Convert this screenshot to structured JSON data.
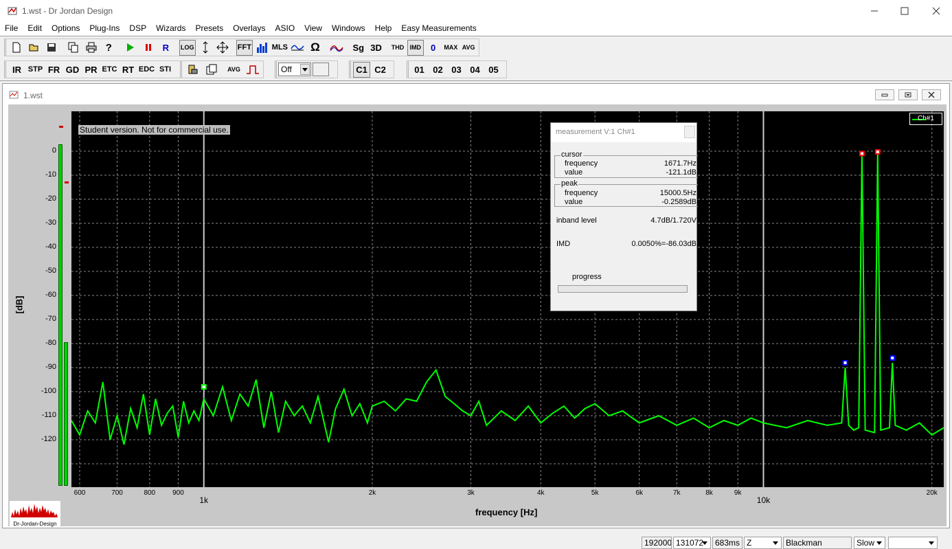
{
  "app": {
    "title": "1.wst - Dr Jordan Design"
  },
  "menu": [
    "File",
    "Edit",
    "Options",
    "Plug-Ins",
    "DSP",
    "Wizards",
    "Presets",
    "Overlays",
    "ASIO",
    "View",
    "Windows",
    "Help",
    "Easy Measurements"
  ],
  "toolbar1": {
    "log": "LOG",
    "fft": "FFT",
    "mls": "MLS",
    "sg": "Sg",
    "three_d": "3D",
    "thd": "THD",
    "imd": "IMD",
    "zero": "0",
    "max": "MAX",
    "avg": "AVG"
  },
  "toolbar2": {
    "ir": "IR",
    "stp": "STP",
    "fr": "FR",
    "gd": "GD",
    "pr": "PR",
    "etc": "ETC",
    "rt": "RT",
    "edc": "EDC",
    "sti": "STI",
    "avg": "AVG",
    "off_value": "Off",
    "c1": "C1",
    "c2": "C2",
    "presets": [
      "01",
      "02",
      "03",
      "04",
      "05"
    ]
  },
  "child": {
    "title": "1.wst"
  },
  "graph": {
    "student_notice": "Student version. Not for commercial use.",
    "legend": "Ch#1",
    "logo_text": "Dr-Jordan-Design"
  },
  "measurement": {
    "title": "measurement V:1 Ch#1",
    "cursor_label": "cursor",
    "cursor_freq_label": "frequency",
    "cursor_freq": "1671.7Hz",
    "cursor_value_label": "value",
    "cursor_value": "-121.1dB",
    "peak_label": "peak",
    "peak_freq_label": "frequency",
    "peak_freq": "15000.5Hz",
    "peak_value_label": "value",
    "peak_value": "-0.2589dB",
    "inband_label": "inband level",
    "inband_value": "4.7dB/1.720V",
    "imd_label": "IMD",
    "imd_value": "0.0050%=-86.03dB",
    "progress_label": "progress",
    "progress": 0
  },
  "status": {
    "rate": "192000",
    "fft_size": "131072",
    "duration": "683ms",
    "weighting": "Z",
    "window": "Blackman",
    "speed": "Slow",
    "extra": ""
  },
  "colors": {
    "trace": "#00ff00",
    "plot_bg": "#000000",
    "marker_red": "#ff0000",
    "marker_blue": "#0000ff"
  },
  "chart_data": {
    "type": "line",
    "xlabel": "frequency [Hz]",
    "ylabel": "[dB]",
    "x_scale": "log",
    "xlim": [
      580,
      21000
    ],
    "ylim": [
      -140,
      10
    ],
    "y_ticks": [
      "0",
      "-10",
      "-20",
      "-30",
      "-40",
      "-50",
      "-60",
      "-70",
      "-80",
      "-90",
      "-100",
      "-110",
      "-120"
    ],
    "x_ticks_minor": [
      {
        "value": 600,
        "label": "600"
      },
      {
        "value": 700,
        "label": "700"
      },
      {
        "value": 800,
        "label": "800"
      },
      {
        "value": 900,
        "label": "900"
      },
      {
        "value": 2000,
        "label": "2k"
      },
      {
        "value": 3000,
        "label": "3k"
      },
      {
        "value": 4000,
        "label": "4k"
      },
      {
        "value": 5000,
        "label": "5k"
      },
      {
        "value": 6000,
        "label": "6k"
      },
      {
        "value": 7000,
        "label": "7k"
      },
      {
        "value": 8000,
        "label": "8k"
      },
      {
        "value": 9000,
        "label": "9k"
      },
      {
        "value": 20000,
        "label": "20k"
      }
    ],
    "x_ticks_major": [
      {
        "value": 1000,
        "label": "1k"
      },
      {
        "value": 10000,
        "label": "10k"
      }
    ],
    "grid": true,
    "legend_position": "top-right",
    "series": [
      {
        "name": "Ch#1",
        "points": [
          [
            580,
            -112
          ],
          [
            600,
            -118
          ],
          [
            620,
            -108
          ],
          [
            640,
            -113
          ],
          [
            660,
            -96
          ],
          [
            680,
            -120
          ],
          [
            700,
            -110
          ],
          [
            720,
            -122
          ],
          [
            740,
            -107
          ],
          [
            760,
            -115
          ],
          [
            780,
            -101
          ],
          [
            800,
            -118
          ],
          [
            820,
            -103
          ],
          [
            840,
            -114
          ],
          [
            860,
            -109
          ],
          [
            880,
            -106
          ],
          [
            900,
            -119
          ],
          [
            920,
            -104
          ],
          [
            940,
            -113
          ],
          [
            960,
            -108
          ],
          [
            980,
            -112
          ],
          [
            1000,
            -103
          ],
          [
            1040,
            -110
          ],
          [
            1080,
            -98
          ],
          [
            1120,
            -112
          ],
          [
            1160,
            -101
          ],
          [
            1200,
            -106
          ],
          [
            1240,
            -95
          ],
          [
            1280,
            -115
          ],
          [
            1320,
            -100
          ],
          [
            1360,
            -117
          ],
          [
            1400,
            -104
          ],
          [
            1450,
            -110
          ],
          [
            1500,
            -106
          ],
          [
            1550,
            -113
          ],
          [
            1600,
            -102
          ],
          [
            1671,
            -121
          ],
          [
            1720,
            -107
          ],
          [
            1780,
            -99
          ],
          [
            1840,
            -110
          ],
          [
            1900,
            -105
          ],
          [
            1960,
            -113
          ],
          [
            2000,
            -106
          ],
          [
            2100,
            -104
          ],
          [
            2200,
            -108
          ],
          [
            2300,
            -103
          ],
          [
            2400,
            -104
          ],
          [
            2500,
            -96
          ],
          [
            2600,
            -91
          ],
          [
            2700,
            -102
          ],
          [
            2800,
            -105
          ],
          [
            2900,
            -108
          ],
          [
            3000,
            -110
          ],
          [
            3100,
            -104
          ],
          [
            3200,
            -114
          ],
          [
            3400,
            -108
          ],
          [
            3600,
            -112
          ],
          [
            3800,
            -106
          ],
          [
            4000,
            -113
          ],
          [
            4200,
            -109
          ],
          [
            4400,
            -106
          ],
          [
            4600,
            -111
          ],
          [
            4800,
            -107
          ],
          [
            5000,
            -105
          ],
          [
            5300,
            -110
          ],
          [
            5600,
            -108
          ],
          [
            6000,
            -113
          ],
          [
            6500,
            -110
          ],
          [
            7000,
            -114
          ],
          [
            7500,
            -111
          ],
          [
            8000,
            -115
          ],
          [
            8500,
            -112
          ],
          [
            9000,
            -114
          ],
          [
            9500,
            -111
          ],
          [
            10000,
            -113
          ],
          [
            11000,
            -115
          ],
          [
            12000,
            -112
          ],
          [
            13000,
            -114
          ],
          [
            13800,
            -113
          ],
          [
            14000,
            -90
          ],
          [
            14200,
            -114
          ],
          [
            14500,
            -116
          ],
          [
            14800,
            -115
          ],
          [
            15000,
            -0.26
          ],
          [
            15200,
            -116
          ],
          [
            15800,
            -117
          ],
          [
            16000,
            -0.3
          ],
          [
            16200,
            -116
          ],
          [
            16800,
            -115
          ],
          [
            17000,
            -88
          ],
          [
            17200,
            -114
          ],
          [
            18000,
            -116
          ],
          [
            19000,
            -113
          ],
          [
            20000,
            -118
          ],
          [
            21000,
            -115
          ]
        ]
      }
    ],
    "markers": [
      {
        "x": 1000,
        "y": -98,
        "color": "green"
      },
      {
        "x": 14000,
        "y": -88,
        "color": "blue"
      },
      {
        "x": 15000,
        "y": -1,
        "color": "red"
      },
      {
        "x": 16000,
        "y": -0.3,
        "color": "red"
      },
      {
        "x": 17000,
        "y": -86,
        "color": "blue"
      }
    ]
  }
}
